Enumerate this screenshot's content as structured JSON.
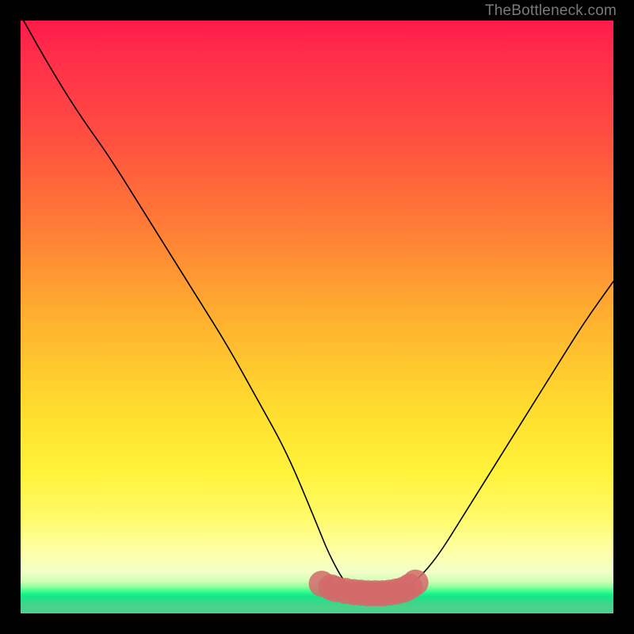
{
  "watermark": "TheBottleneck.com",
  "chart_data": {
    "type": "line",
    "title": "",
    "xlabel": "",
    "ylabel": "",
    "xlim": [
      0,
      100
    ],
    "ylim": [
      0,
      100
    ],
    "background_gradient": {
      "orientation": "vertical",
      "stops": [
        {
          "pct": 0,
          "color": "#ff1a4a"
        },
        {
          "pct": 34,
          "color": "#ff7a36"
        },
        {
          "pct": 66,
          "color": "#ffde2e"
        },
        {
          "pct": 90,
          "color": "#fdffab"
        },
        {
          "pct": 96,
          "color": "#3bff8e"
        },
        {
          "pct": 100,
          "color": "#4cd18a"
        }
      ]
    },
    "series": [
      {
        "name": "bottleneck-curve",
        "color": "#000000",
        "x": [
          0.5,
          5,
          10,
          15,
          20,
          25,
          30,
          35,
          40,
          45,
          50,
          52,
          55,
          58,
          61,
          63,
          66,
          70,
          75,
          80,
          85,
          90,
          95,
          100
        ],
        "values": [
          100,
          92,
          84,
          77,
          69,
          61,
          53,
          45,
          36,
          27,
          15,
          10,
          4.5,
          3.6,
          3.4,
          3.6,
          4.8,
          9,
          17,
          25,
          33,
          41,
          49,
          56
        ]
      }
    ],
    "markers": {
      "name": "flat-bottom-highlight",
      "color": "#d46a6a",
      "radius": 2.2,
      "x": [
        50.8,
        52.4,
        53.2,
        54.8,
        56.2,
        57.4,
        58.6,
        59.8,
        61.0,
        62.2,
        63.4,
        64.6,
        65.6,
        66.6
      ],
      "values": [
        5.0,
        4.4,
        4.1,
        3.8,
        3.6,
        3.5,
        3.4,
        3.4,
        3.4,
        3.5,
        3.7,
        4.0,
        4.5,
        5.2
      ]
    }
  }
}
